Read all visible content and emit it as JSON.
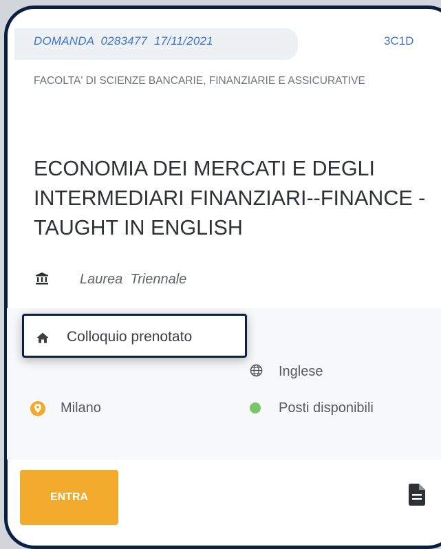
{
  "header": {
    "domanda_label": "DOMANDA",
    "domanda_number": "0283477",
    "domanda_date": "17/11/2021",
    "code": "3C1D"
  },
  "faculty": "FACOLTA' DI SCIENZE BANCARIE, FINANZIARIE E ASSICURATIVE",
  "course_title": "ECONOMIA DEI MERCATI E DEGLI INTERMEDIARI FINANZIARI--FINANCE - TAUGHT IN ENGLISH",
  "degree": {
    "type": "Laurea",
    "level": "Triennale",
    "icon": "building-icon"
  },
  "tooltip": {
    "label": "Colloquio prenotato",
    "icon": "home-icon"
  },
  "info": {
    "language": {
      "label": "Inglese",
      "icon": "globe-icon"
    },
    "location": {
      "label": "Milano",
      "icon": "location-pin-icon"
    },
    "availability": {
      "label": "Posti disponibili",
      "icon": "green-dot-icon"
    }
  },
  "actions": {
    "enter_label": "ENTRA",
    "document_icon": "document-icon"
  },
  "colors": {
    "accent_blue": "#3f75c9",
    "border_navy": "#0b1f45",
    "button_orange": "#f2aa2d",
    "location_orange": "#f2aa2d",
    "availability_green": "#7cc66a"
  }
}
